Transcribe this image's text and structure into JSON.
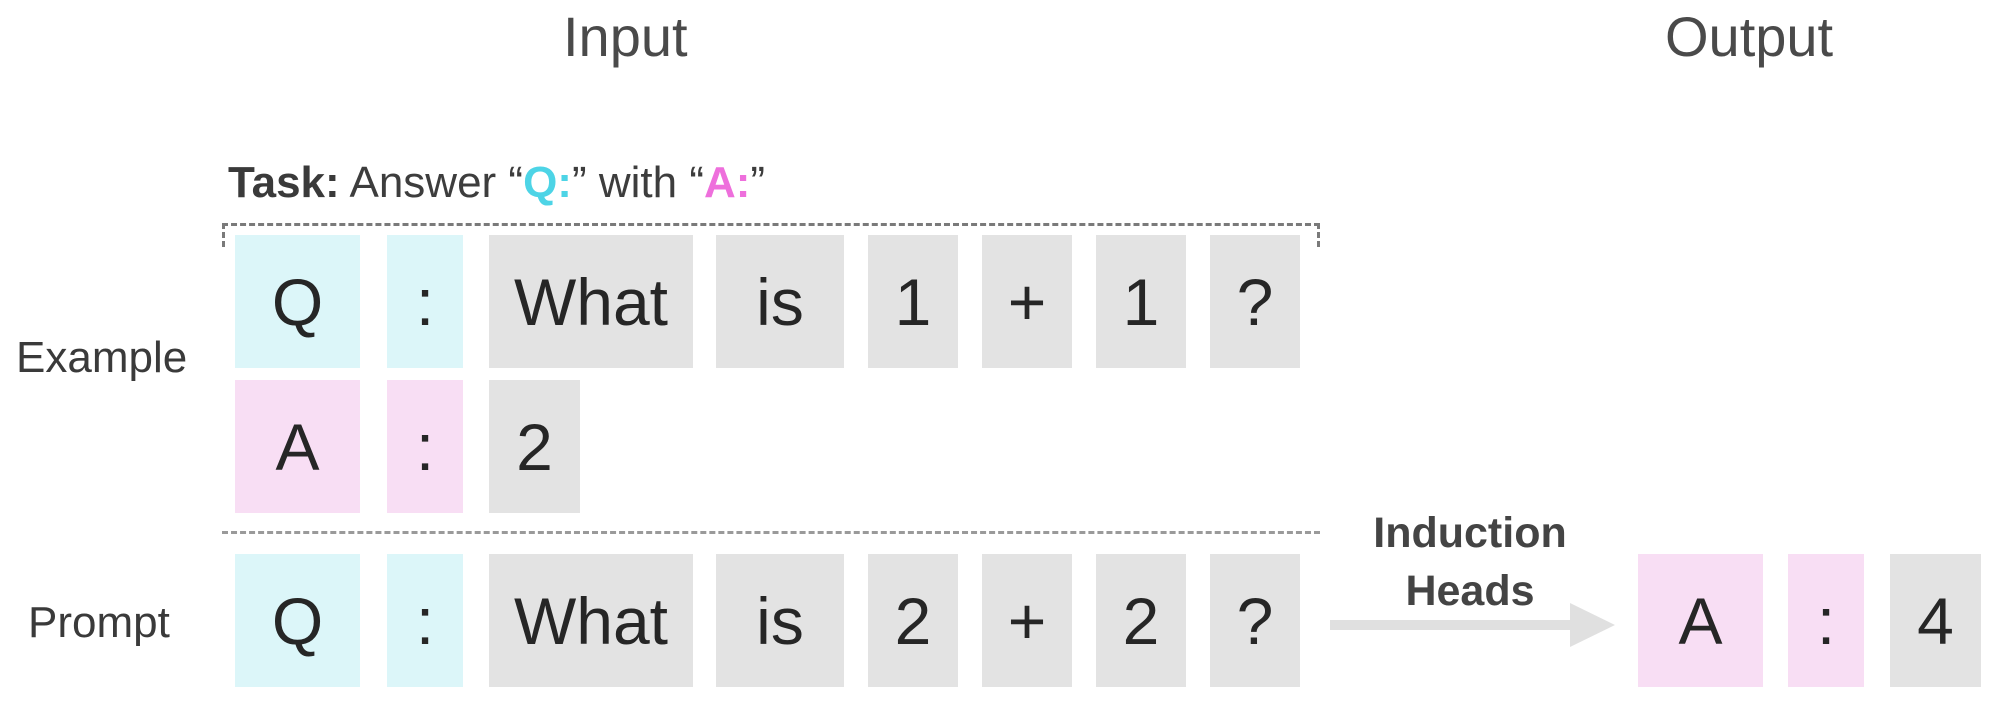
{
  "headings": {
    "input": "Input",
    "output": "Output"
  },
  "task": {
    "bold": "Task:",
    "text1": " Answer “",
    "q": "Q:",
    "text2": "” with “",
    "a": "A:",
    "text3": "”"
  },
  "labels": {
    "example": "Example",
    "prompt": "Prompt"
  },
  "example_q_tokens": [
    "Q",
    ":",
    "What",
    "is",
    "1",
    "+",
    "1",
    "?"
  ],
  "example_a_tokens": [
    "A",
    ":",
    "2"
  ],
  "prompt_tokens": [
    "Q",
    ":",
    "What",
    "is",
    "2",
    "+",
    "2",
    "?"
  ],
  "arrow_label": {
    "line1": "Induction",
    "line2": "Heads"
  },
  "output_tokens": [
    "A",
    ":",
    "4"
  ],
  "colors": {
    "q": "#dcf6f9",
    "a": "#f8def4",
    "word": "#e3e3e3",
    "q_text": "#4dd4e6",
    "a_text": "#ee6fdc"
  }
}
